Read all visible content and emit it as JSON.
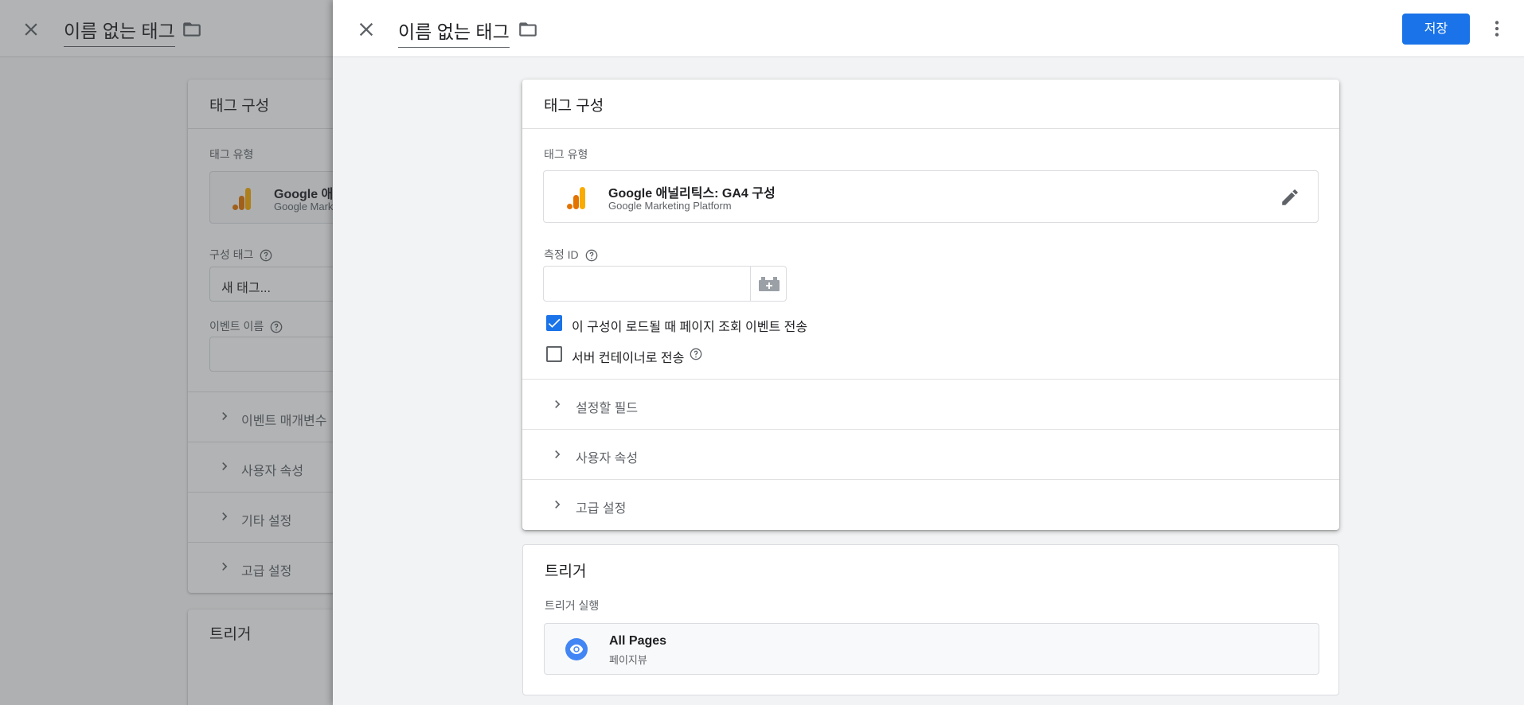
{
  "window": {
    "title": "이름 없는 태그",
    "save_label": "저장"
  },
  "tag_config": {
    "heading": "태그 구성",
    "tag_type_label": "태그 유형",
    "tag_type_name": "Google 애널리틱스: GA4 구성",
    "tag_type_vendor": "Google Marketing Platform",
    "measurement_id_label": "측정 ID",
    "measurement_id_value": "",
    "send_pageview_label": "이 구성이 로드될 때 페이지 조회 이벤트 전송",
    "send_pageview_checked": true,
    "send_server_label": "서버 컨테이너로 전송",
    "send_server_checked": false,
    "sections": [
      "설정할 필드",
      "사용자 속성",
      "고급 설정"
    ]
  },
  "triggers": {
    "heading": "트리거",
    "firing_label": "트리거 실행",
    "trigger_name": "All Pages",
    "trigger_type": "페이지뷰"
  },
  "background": {
    "title": "이름 없는 태그",
    "card_heading": "태그 구성",
    "tag_type_label": "태그 유형",
    "tag_type_name": "Google 애널",
    "tag_type_vendor": "Google Marke",
    "config_tag_label": "구성 태그",
    "config_tag_value": "새 태그...",
    "event_name_label": "이벤트 이름",
    "sections": [
      "이벤트 매개변수",
      "사용자 속성",
      "기타 설정",
      "고급 설정"
    ],
    "trigger_heading": "트리거"
  },
  "colors": {
    "accent": "#1a73e8",
    "ga_orange": "#f9ab00",
    "ga_dark_orange": "#e37400",
    "trigger_blue": "#4285f4"
  },
  "icons": {
    "close": "close-icon",
    "folder": "folder-icon",
    "more": "more-vert-icon",
    "edit": "pencil-icon",
    "variable": "variable-brick-icon",
    "help": "help-circle-icon",
    "expand": "chevron-right-icon",
    "pageview": "eye-icon",
    "analytics": "google-analytics-icon"
  }
}
